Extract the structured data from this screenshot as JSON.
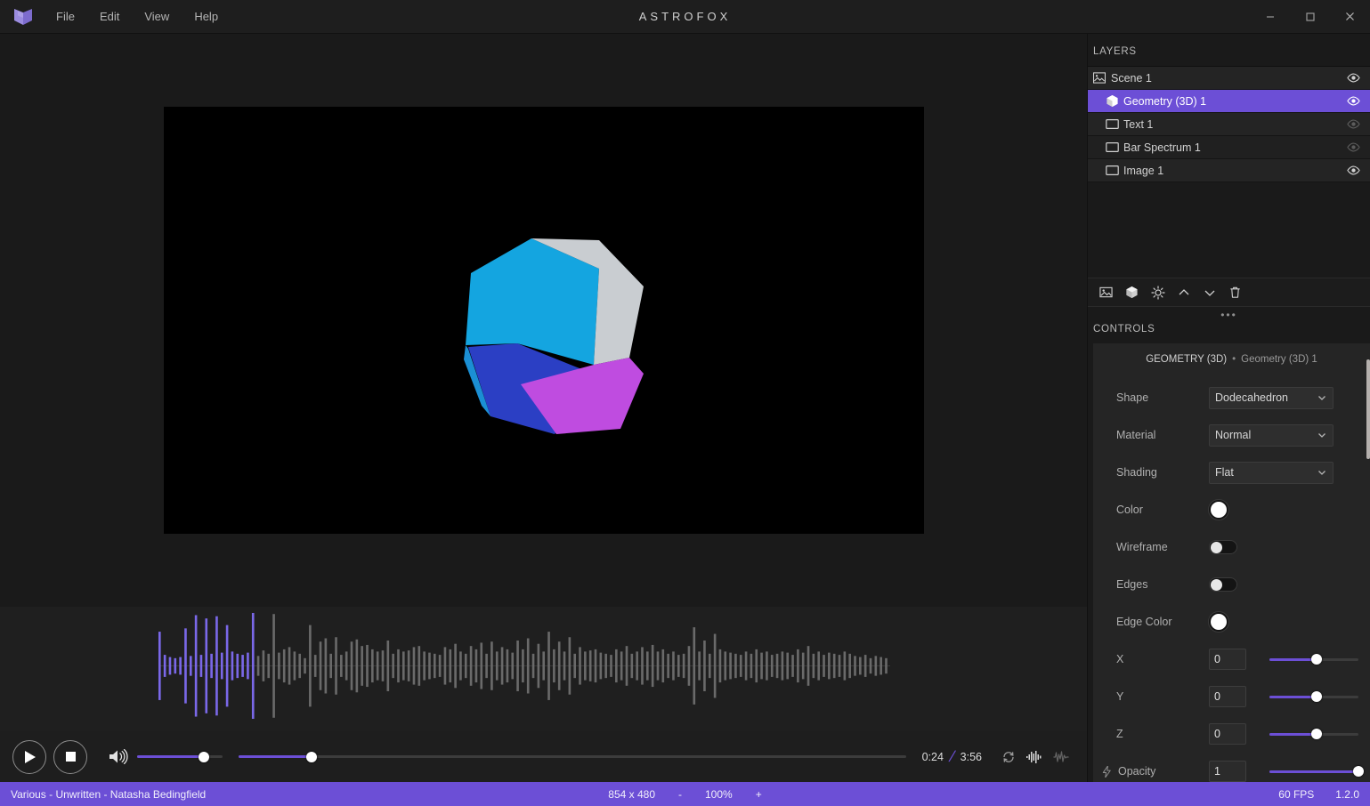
{
  "titlebar": {
    "logo_icon": "astrofox-logo-icon",
    "title": "ASTROFOX",
    "menu": [
      {
        "label": "File"
      },
      {
        "label": "Edit"
      },
      {
        "label": "View"
      },
      {
        "label": "Help"
      }
    ],
    "window_controls": {
      "minimize_icon": "minimize-icon",
      "maximize_icon": "maximize-icon",
      "close_icon": "close-icon"
    }
  },
  "layers_panel": {
    "header": "LAYERS",
    "items": [
      {
        "label": "Scene 1",
        "icon": "scene-image-icon",
        "selected": false,
        "child": false,
        "visible": true
      },
      {
        "label": "Geometry (3D) 1",
        "icon": "cube-3d-icon",
        "selected": true,
        "child": true,
        "visible": true
      },
      {
        "label": "Text 1",
        "icon": "rectangle-icon",
        "selected": false,
        "child": true,
        "visible": false
      },
      {
        "label": "Bar Spectrum 1",
        "icon": "rectangle-icon",
        "selected": false,
        "child": true,
        "visible": false
      },
      {
        "label": "Image 1",
        "icon": "rectangle-icon",
        "selected": false,
        "child": true,
        "visible": true
      }
    ],
    "toolbar": [
      {
        "icon": "add-image-layer-icon",
        "name": "add-image-layer-button"
      },
      {
        "icon": "add-3d-layer-icon",
        "name": "add-3d-layer-button"
      },
      {
        "icon": "add-effect-icon",
        "name": "add-effect-button"
      },
      {
        "icon": "move-up-icon",
        "name": "move-layer-up-button"
      },
      {
        "icon": "move-down-icon",
        "name": "move-layer-down-button"
      },
      {
        "icon": "delete-icon",
        "name": "delete-layer-button"
      }
    ],
    "drag_handle": "•••"
  },
  "controls_panel": {
    "header": "CONTROLS",
    "card_title": "GEOMETRY (3D)",
    "card_separator": "•",
    "card_subtitle": "Geometry (3D) 1",
    "rows": [
      {
        "label": "Shape",
        "type": "select",
        "value": "Dodecahedron"
      },
      {
        "label": "Material",
        "type": "select",
        "value": "Normal"
      },
      {
        "label": "Shading",
        "type": "select",
        "value": "Flat"
      },
      {
        "label": "Color",
        "type": "color",
        "value": "#ffffff"
      },
      {
        "label": "Wireframe",
        "type": "toggle",
        "value": "off"
      },
      {
        "label": "Edges",
        "type": "toggle",
        "value": "off"
      },
      {
        "label": "Edge Color",
        "type": "color",
        "value": "#ffffff"
      },
      {
        "label": "X",
        "type": "slider",
        "value": "0",
        "percent": 53
      },
      {
        "label": "Y",
        "type": "slider",
        "value": "0",
        "percent": 53
      },
      {
        "label": "Z",
        "type": "slider",
        "value": "0",
        "percent": 53
      },
      {
        "label": "Opacity",
        "type": "slider",
        "value": "1",
        "percent": 100,
        "bolt": true
      }
    ]
  },
  "player": {
    "play_icon": "play-icon",
    "stop_icon": "stop-icon",
    "volume_icon": "volume-high-icon",
    "volume_percent": 78,
    "seek_percent": 11,
    "current_time": "0:24",
    "separator": "/",
    "total_time": "3:56",
    "buttons": [
      {
        "icon": "loop-icon",
        "name": "loop-button",
        "active": false
      },
      {
        "icon": "waveform-bars-icon",
        "name": "spectrum-view-button",
        "active": true
      },
      {
        "icon": "waveform-line-icon",
        "name": "waveform-view-button",
        "active": false
      }
    ]
  },
  "statusbar": {
    "track": "Various - Unwritten - Natasha Bedingfield",
    "resolution": "854 x 480",
    "zoom_out": "-",
    "zoom_level": "100%",
    "zoom_in": "+",
    "fps": "60 FPS",
    "version": "1.2.0"
  },
  "theme": {
    "accent": "#6c4fd6",
    "panel_bg": "#1a1a1a",
    "card_bg": "#252525",
    "row_bg": "#242424",
    "canvas_bg": "#000000"
  },
  "preview": {
    "shape": "dodecahedron",
    "face_colors": [
      "#14a5e0",
      "#c9cdd1",
      "#bf4ce0",
      "#2b3fc4",
      "#1b8fd4"
    ]
  },
  "waveform": {
    "played_fraction": 0.112,
    "played_color": "#7a68e8",
    "unplayed_color": "#6a6a6a",
    "bars": [
      62,
      20,
      16,
      14,
      16,
      68,
      18,
      92,
      20,
      86,
      22,
      90,
      24,
      74,
      26,
      22,
      20,
      24,
      96,
      18,
      28,
      22,
      94,
      24,
      30,
      34,
      26,
      22,
      14,
      74,
      20,
      44,
      50,
      22,
      52,
      20,
      26,
      44,
      48,
      36,
      38,
      30,
      26,
      28,
      46,
      22,
      30,
      26,
      28,
      34,
      36,
      26,
      24,
      22,
      20,
      34,
      30,
      40,
      26,
      22,
      36,
      30,
      42,
      22,
      44,
      26,
      34,
      30,
      24,
      46,
      30,
      50,
      22,
      40,
      26,
      62,
      30,
      44,
      26,
      52,
      22,
      34,
      26,
      28,
      30,
      24,
      22,
      20,
      30,
      26,
      36,
      22,
      26,
      34,
      26,
      38,
      26,
      30,
      22,
      26,
      20,
      22,
      36,
      70,
      26,
      46,
      22,
      58,
      30,
      26,
      24,
      22,
      20,
      26,
      22,
      30,
      24,
      26,
      20,
      22,
      26,
      24,
      20,
      30,
      24,
      36,
      22,
      26,
      20,
      24,
      22,
      20,
      26,
      22,
      18,
      16,
      20,
      14,
      18,
      16,
      14
    ]
  }
}
